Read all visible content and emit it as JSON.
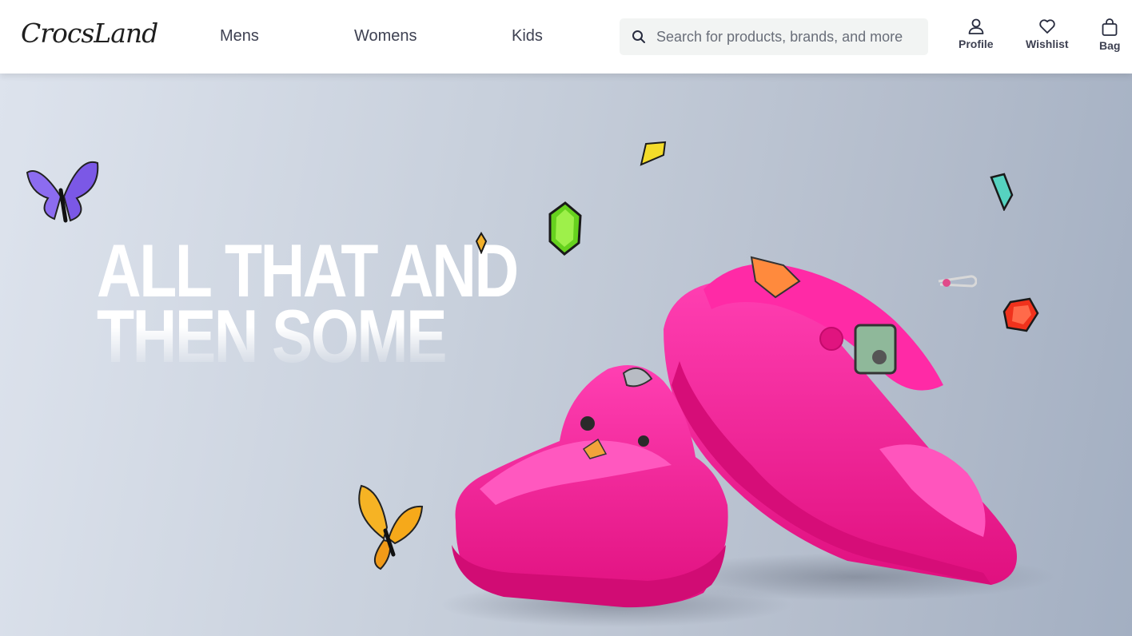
{
  "brand": {
    "logo_text": "CrocsLand"
  },
  "nav": {
    "items": [
      {
        "label": "Mens"
      },
      {
        "label": "Womens"
      },
      {
        "label": "Kids"
      }
    ]
  },
  "search": {
    "placeholder": "Search for products, brands, and more",
    "value": ""
  },
  "actions": {
    "profile": "Profile",
    "wishlist": "Wishlist",
    "bag": "Bag"
  },
  "hero": {
    "headline_line1": "ALL THAT AND",
    "headline_line2": "THEN SOME",
    "product_color": "#ff1f9f"
  },
  "colors": {
    "nav_text": "#3e4152",
    "hero_bg": "#c8d0dc",
    "accent_pink": "#ff1f9f"
  },
  "icons": [
    "search-icon",
    "profile-icon",
    "heart-icon",
    "bag-icon"
  ]
}
